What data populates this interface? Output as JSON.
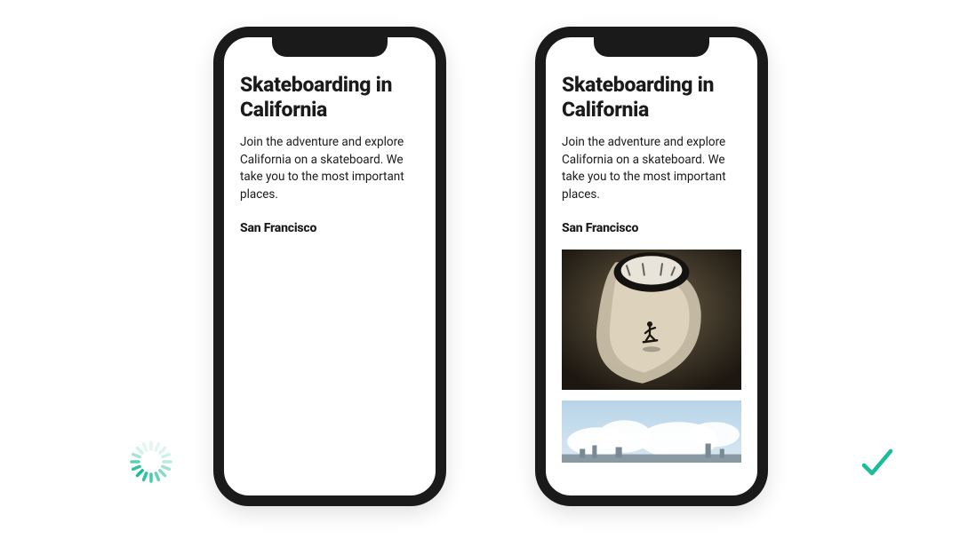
{
  "content": {
    "heading": "Skateboarding in California",
    "description": "Join the adventure and explore California on a skateboard. We take you to the most important places.",
    "location": "San Francisco"
  },
  "phones": {
    "left": {
      "state": "loading"
    },
    "right": {
      "state": "loaded"
    }
  },
  "icons": {
    "spinner": "spinner-icon",
    "checkmark": "checkmark-icon"
  },
  "colors": {
    "accent": "#1abc9c",
    "phoneFrame": "#1a1a1a",
    "text": "#1a1a1a"
  }
}
